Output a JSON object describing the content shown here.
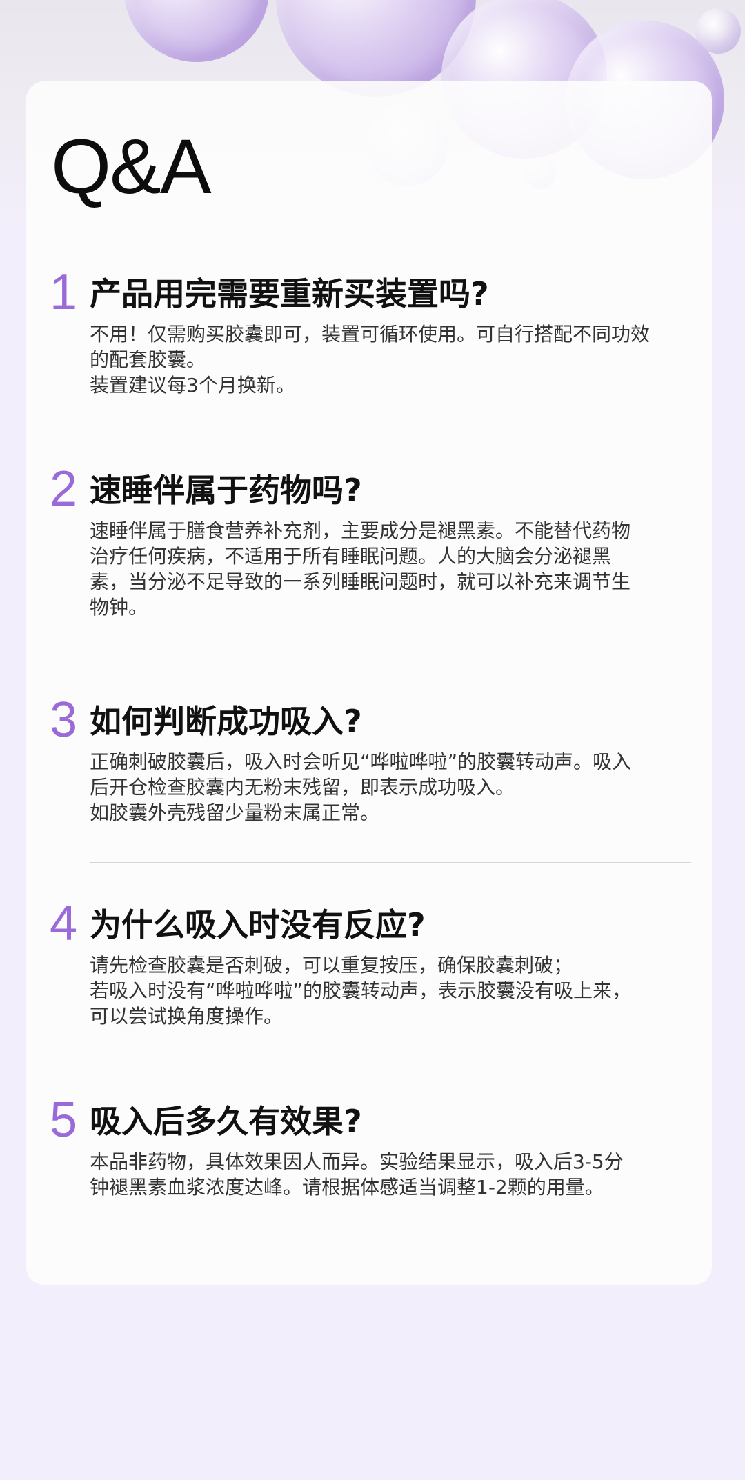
{
  "page": {
    "title": "Q&A",
    "accent_color": "#9a6ad8"
  },
  "qa": [
    {
      "number": "1",
      "question": "产品用完需要重新买装置吗?",
      "answer_lines": [
        "不用！仅需购买胶囊即可，装置可循环使用。可自行搭配不同功效",
        "的配套胶囊。",
        "装置建议每3个月换新。"
      ]
    },
    {
      "number": "2",
      "question": "速睡伴属于药物吗?",
      "answer_lines": [
        "速睡伴属于膳食营养补充剂，主要成分是褪黑素。不能替代药物",
        "治疗任何疾病，不适用于所有睡眠问题。人的大脑会分泌褪黑",
        "素，当分泌不足导致的一系列睡眠问题时，就可以补充来调节生",
        "物钟。"
      ]
    },
    {
      "number": "3",
      "question": "如何判断成功吸入?",
      "answer_lines": [
        "正确刺破胶囊后，吸入时会听见“哗啦哗啦”的胶囊转动声。吸入",
        "后开仓检查胶囊内无粉末残留，即表示成功吸入。",
        "如胶囊外壳残留少量粉末属正常。"
      ]
    },
    {
      "number": "4",
      "question": "为什么吸入时没有反应?",
      "answer_lines": [
        "请先检查胶囊是否刺破，可以重复按压，确保胶囊刺破；",
        "若吸入时没有“哗啦哗啦”的胶囊转动声，表示胶囊没有吸上来，",
        "可以尝试换角度操作。"
      ]
    },
    {
      "number": "5",
      "question": "吸入后多久有效果?",
      "answer_lines": [
        "本品非药物，具体效果因人而异。实验结果显示，吸入后3-5分",
        "钟褪黑素血浆浓度达峰。请根据体感适当调整1-2颗的用量。"
      ]
    }
  ]
}
